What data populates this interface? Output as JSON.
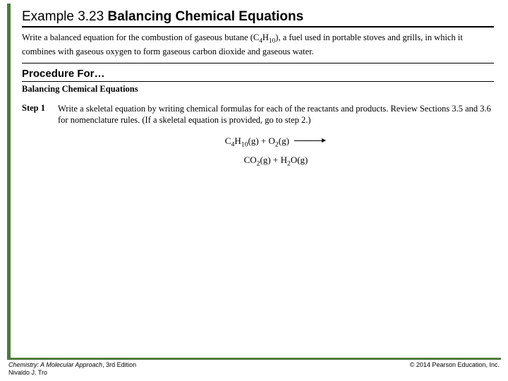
{
  "title": {
    "example": "Example 3.23",
    "name": "Balancing Chemical Equations"
  },
  "problem": {
    "pre": "Write a balanced equation for the combustion of gaseous butane (C",
    "sub1": "4",
    "mid": "H",
    "sub2": "10",
    "post": "), a fuel used in portable stoves and grills, in which it combines with gaseous oxygen to form gaseous carbon dioxide and gaseous water."
  },
  "procedure": {
    "heading": "Procedure For…",
    "subheading": "Balancing Chemical Equations"
  },
  "step": {
    "label": "Step 1",
    "text": "Write a skeletal equation by writing chemical formulas for each of the reactants and products. Review Sections 3.5 and 3.6 for nomenclature rules. (If a skeletal equation is provided, go to step 2.)"
  },
  "equation": {
    "r1": "C",
    "r1s1": "4",
    "r1m": "H",
    "r1s2": "10",
    "r1ph": "(g)",
    "plus": " + ",
    "r2": "O",
    "r2s": "2",
    "r2ph": "(g)",
    "p1": "CO",
    "p1s": "2",
    "p1ph": "(g)",
    "plus2": " + ",
    "p2": "H",
    "p2s": "2",
    "p2m": "O",
    "p2ph": "(g)"
  },
  "footer": {
    "book": "Chemistry: A Molecular Approach",
    "edition": ", 3rd Edition",
    "author": "Nivaldo J. Tro",
    "copyright": "© 2014 Pearson Education, Inc."
  }
}
